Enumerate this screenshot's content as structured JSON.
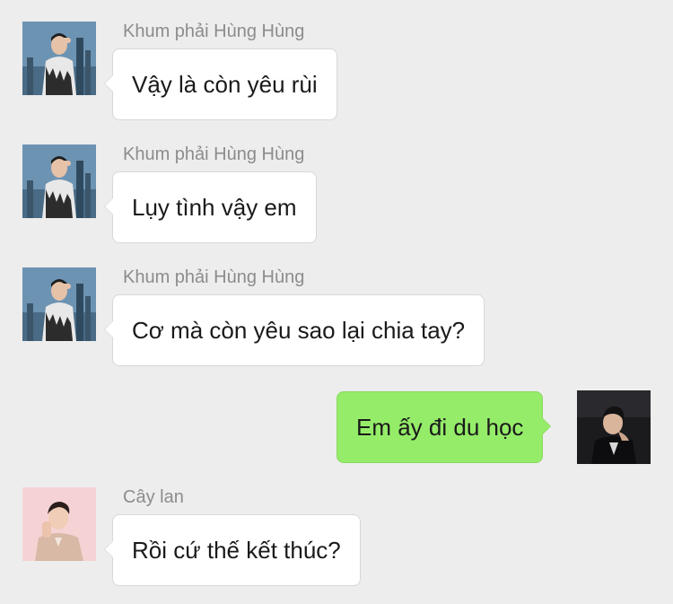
{
  "conversation": {
    "messages": [
      {
        "sender": "Khum phải Hùng Hùng",
        "text": "Vậy là còn yêu rùi",
        "avatar_icon": "city-skyline-avatar-icon"
      },
      {
        "sender": "Khum phải Hùng Hùng",
        "text": "Lụy tình vậy em",
        "avatar_icon": "city-skyline-avatar-icon"
      },
      {
        "sender": "Khum phải Hùng Hùng",
        "text": "Cơ mà còn yêu sao lại chia tay?",
        "avatar_icon": "city-skyline-avatar-icon"
      },
      {
        "sender": "",
        "text": "Em ấy đi du học",
        "avatar_icon": "dark-portrait-avatar-icon"
      },
      {
        "sender": "Cây lan",
        "text": "Rồi cứ thế kết thúc?",
        "avatar_icon": "pink-portrait-avatar-icon"
      }
    ]
  },
  "colors": {
    "background": "#ededed",
    "incoming_bubble": "#ffffff",
    "outgoing_bubble": "#95ec69",
    "sender_name": "#8c8c8c"
  }
}
